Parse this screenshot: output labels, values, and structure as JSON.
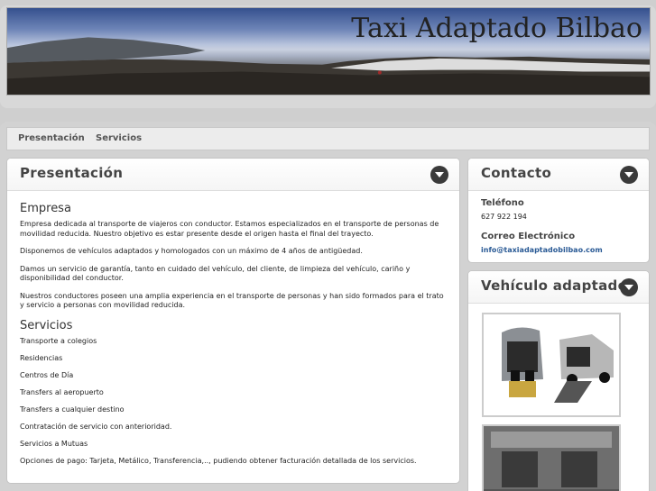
{
  "header": {
    "title": "Taxi Adaptado Bilbao",
    "banner_alt": "Panoramic mountain landscape above clouds"
  },
  "nav": {
    "items": [
      "Presentación",
      "Servicios"
    ]
  },
  "main": {
    "title": "Presentación",
    "empresa_heading": "Empresa",
    "paragraphs": [
      "Empresa dedicada al transporte de viajeros con conductor. Estamos especializados en el transporte de personas de movilidad reducida. Nuestro objetivo es estar presente desde el origen hasta el final del trayecto.",
      "Disponemos de vehículos adaptados y homologados con un máximo de 4 años de antigüedad.",
      "Damos un servicio de garantía, tanto en cuidado del vehículo, del cliente, de limpieza del vehículo, cariño y disponibilidad del conductor.",
      "Nuestros conductores poseen una amplia experiencia en el transporte de personas y han sido formados para el trato y servicio a personas con movilidad reducida."
    ],
    "servicios_heading": "Servicios",
    "services": [
      "Transporte a colegios",
      "Residencias",
      "Centros de Día",
      "Transfers al aeropuerto",
      "Transfers a cualquier destino",
      "Contratación de servicio con anterioridad.",
      "Servicios a Mutuas",
      "Opciones de pago: Tarjeta, Metálico, Transferencia,.., pudiendo obtener facturación detallada de los servicios."
    ]
  },
  "contact": {
    "title": "Contacto",
    "phone_label": "Teléfono",
    "phone": "627 922 194",
    "email_label": "Correo Electrónico",
    "email": "info@taxiadaptadobilbao.com"
  },
  "vehicle": {
    "title": "Vehículo adaptado"
  }
}
